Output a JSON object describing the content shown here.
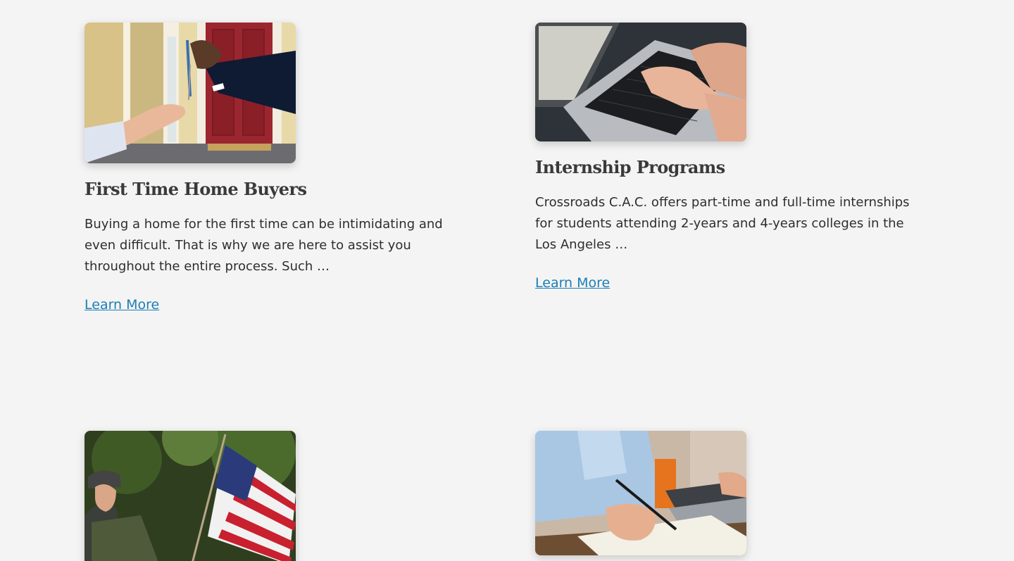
{
  "cards": [
    {
      "title": "First Time Home Buyers",
      "description": "Buying a home for the first time can be intimidating and even difficult. That is why we are here to assist you throughout the entire process. Such …",
      "link_label": "Learn More",
      "image_subject": "house-keys-handover"
    },
    {
      "title": "Internship Programs",
      "description": "Crossroads C.A.C. offers part-time and full-time internships for students attending 2-years and 4-years colleges in the Los Angeles …",
      "link_label": "Learn More",
      "image_subject": "laptop-typing"
    },
    {
      "image_subject": "veteran-with-flag"
    },
    {
      "image_subject": "writing-notes"
    }
  ],
  "colors": {
    "background": "#f4f4f4",
    "link": "#1a7fb5",
    "title": "#3a3a3a",
    "body_text": "#2e2e2e"
  }
}
